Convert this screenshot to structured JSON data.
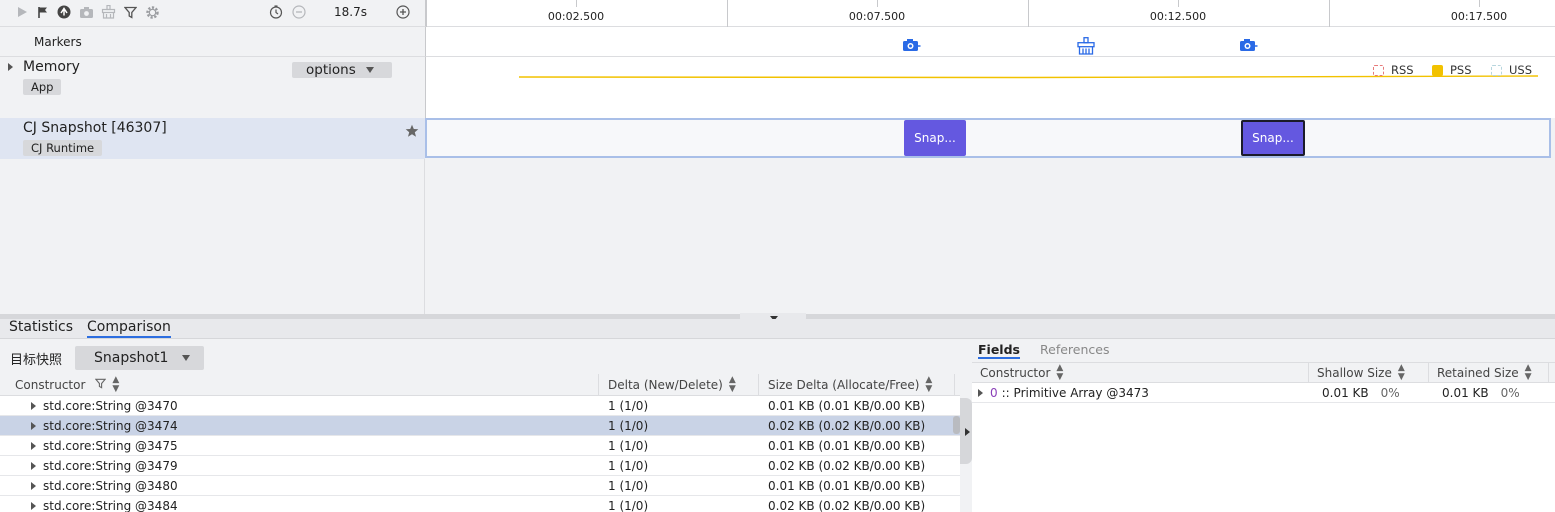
{
  "toolbar": {
    "icons": [
      "play-icon",
      "flag-icon",
      "add-marker-icon",
      "camera-icon",
      "gc-icon",
      "filter-icon",
      "gear-icon",
      "timer-icon",
      "zoom-out-icon",
      "zoom-in-icon"
    ],
    "duration": "18.7s"
  },
  "ruler": {
    "labels": [
      "00:02.500",
      "00:07.500",
      "00:12.500",
      "00:17.500"
    ]
  },
  "markers": {
    "label": "Markers",
    "icons": [
      "camera-marker-icon",
      "gc-marker-icon",
      "camera-marker-icon"
    ]
  },
  "memory": {
    "title": "Memory",
    "tag": "App",
    "options_label": "options",
    "legend": [
      {
        "label": "RSS",
        "color": "#e77b7b",
        "filled": false
      },
      {
        "label": "PSS",
        "color": "#f2c200",
        "filled": true
      },
      {
        "label": "USS",
        "color": "#b7d6de",
        "filled": false
      }
    ],
    "line_color": "#f2c200"
  },
  "snapshot_row": {
    "title": "CJ Snapshot [46307]",
    "tag": "CJ Runtime",
    "blocks": [
      {
        "label": "Snap...",
        "selected": false
      },
      {
        "label": "Snap...",
        "selected": true
      }
    ],
    "block_color": "#6458e0"
  },
  "bottom_tabs": [
    "Statistics",
    "Comparison"
  ],
  "active_tab": "Comparison",
  "target": {
    "label": "目标快照",
    "selected": "Snapshot1"
  },
  "comparison_table": {
    "headers": [
      "Constructor",
      "Delta (New/Delete)",
      "Size Delta (Allocate/Free)"
    ],
    "rows": [
      {
        "constructor": "std.core:String @3470",
        "delta": "1 (1/0)",
        "size_delta": "0.01 KB (0.01 KB/0.00 KB)",
        "selected": false
      },
      {
        "constructor": "std.core:String @3474",
        "delta": "1 (1/0)",
        "size_delta": "0.02 KB (0.02 KB/0.00 KB)",
        "selected": true
      },
      {
        "constructor": "std.core:String @3475",
        "delta": "1 (1/0)",
        "size_delta": "0.01 KB (0.01 KB/0.00 KB)",
        "selected": false
      },
      {
        "constructor": "std.core:String @3479",
        "delta": "1 (1/0)",
        "size_delta": "0.02 KB (0.02 KB/0.00 KB)",
        "selected": false
      },
      {
        "constructor": "std.core:String @3480",
        "delta": "1 (1/0)",
        "size_delta": "0.01 KB (0.01 KB/0.00 KB)",
        "selected": false
      },
      {
        "constructor": "std.core:String @3484",
        "delta": "1 (1/0)",
        "size_delta": "0.02 KB (0.02 KB/0.00 KB)",
        "selected": false
      }
    ]
  },
  "right_panel": {
    "tabs": [
      "Fields",
      "References"
    ],
    "active_tab": "Fields",
    "headers": [
      "Constructor",
      "Shallow Size",
      "Retained Size"
    ],
    "rows": [
      {
        "index": "0",
        "name": ":: Primitive Array @3473",
        "shallow": "0.01 KB",
        "shallow_pct": "0%",
        "retained": "0.01 KB",
        "retained_pct": "0%"
      }
    ]
  }
}
